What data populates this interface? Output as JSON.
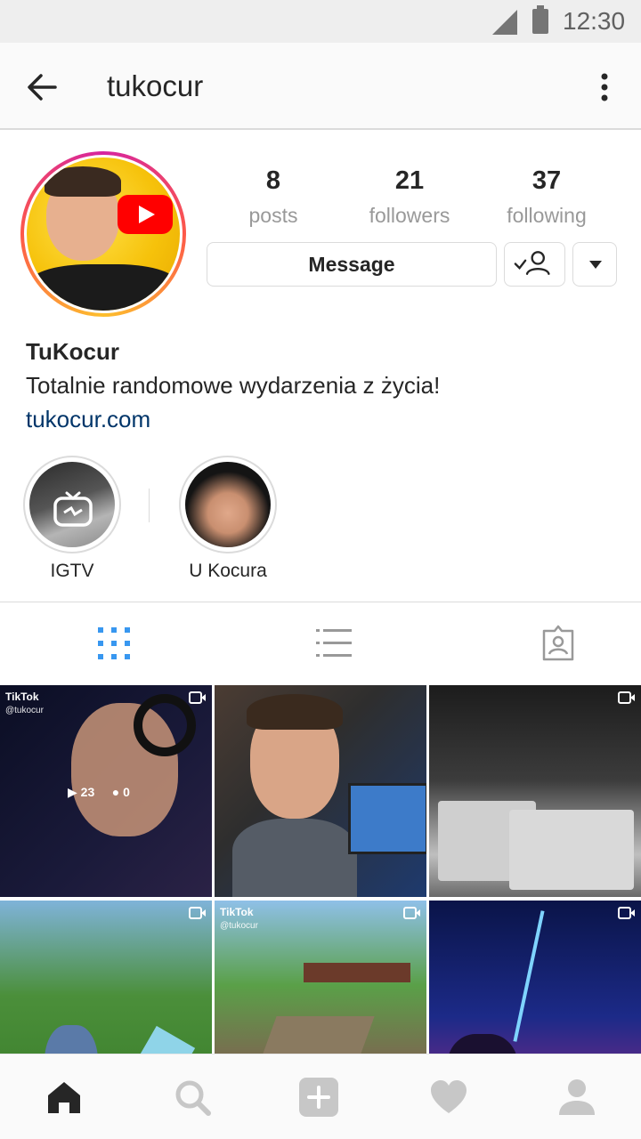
{
  "status_bar": {
    "time": "12:30",
    "icons": [
      "signal-icon",
      "battery-icon"
    ]
  },
  "header": {
    "title": "tukocur",
    "back_icon": "arrow-left-icon",
    "menu_icon": "more-vertical-icon"
  },
  "profile": {
    "stats": [
      {
        "value": "8",
        "label": "posts"
      },
      {
        "value": "21",
        "label": "followers"
      },
      {
        "value": "37",
        "label": "following"
      }
    ],
    "message_label": "Message",
    "name": "TuKocur",
    "bio": "Totalnie randomowe wydarzenia z życia!",
    "website": "tukocur.com"
  },
  "highlights": [
    {
      "label": "IGTV"
    },
    {
      "label": "U Kocura"
    }
  ],
  "tabs": [
    "grid-icon",
    "list-icon",
    "tagged-icon"
  ],
  "grid": {
    "posts": [
      {
        "tiktok_label": "TikTok",
        "tiktok_handle": "@tukocur",
        "plays": "23",
        "comments": "0"
      },
      {},
      {},
      {},
      {
        "tiktok_label": "TikTok",
        "tiktok_handle": "@tukocur"
      },
      {}
    ]
  },
  "bottom_nav": [
    "home-icon",
    "search-icon",
    "add-icon",
    "heart-icon",
    "profile-icon"
  ],
  "colors": {
    "link": "#003569",
    "active_tab": "#3897f0",
    "muted": "#999999"
  }
}
